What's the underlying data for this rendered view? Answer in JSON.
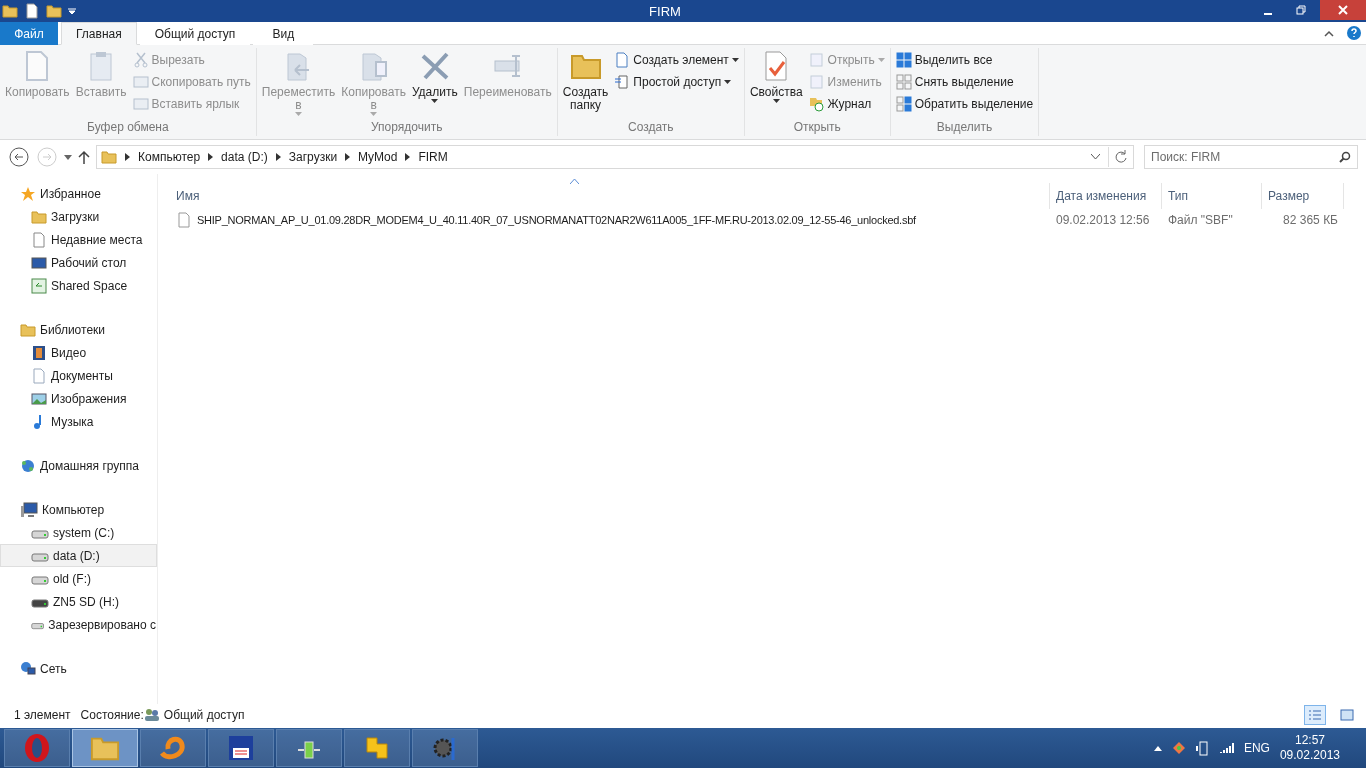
{
  "window": {
    "title": "FIRM"
  },
  "ribbon": {
    "tabs": [
      {
        "label": "Файл",
        "kind": "file",
        "selected": false
      },
      {
        "label": "Главная",
        "kind": "tab",
        "selected": true
      },
      {
        "label": "Общий доступ",
        "kind": "tab",
        "selected": false
      },
      {
        "label": "Вид",
        "kind": "tab",
        "selected": false
      }
    ],
    "groups": [
      {
        "label": "Буфер обмена",
        "large": [
          {
            "label": "Копировать",
            "disabled": true,
            "dropdown": false
          },
          {
            "label": "Вставить",
            "disabled": true,
            "dropdown": false
          }
        ],
        "small": [
          {
            "label": "Вырезать",
            "disabled": true,
            "dropdown": false
          },
          {
            "label": "Скопировать путь",
            "disabled": true,
            "dropdown": false
          },
          {
            "label": "Вставить ярлык",
            "disabled": true,
            "dropdown": false
          }
        ]
      },
      {
        "label": "Упорядочить",
        "large": [
          {
            "label": "Переместить\nв",
            "disabled": true,
            "dropdown": true
          },
          {
            "label": "Копировать\nв",
            "disabled": true,
            "dropdown": true
          },
          {
            "label": "Удалить",
            "disabled": false,
            "dropdown": true
          },
          {
            "label": "Переименовать",
            "disabled": true,
            "dropdown": false
          }
        ]
      },
      {
        "label": "Создать",
        "large": [
          {
            "label": "Создать\nпапку",
            "disabled": false,
            "dropdown": false
          }
        ],
        "small": [
          {
            "label": "Создать элемент",
            "disabled": false,
            "dropdown": true
          },
          {
            "label": "Простой доступ",
            "disabled": false,
            "dropdown": true
          }
        ]
      },
      {
        "label": "Открыть",
        "large": [
          {
            "label": "Свойства",
            "disabled": false,
            "dropdown": true
          }
        ],
        "small": [
          {
            "label": "Открыть",
            "disabled": true,
            "dropdown": true
          },
          {
            "label": "Изменить",
            "disabled": true,
            "dropdown": false
          },
          {
            "label": "Журнал",
            "disabled": false,
            "dropdown": false
          }
        ]
      },
      {
        "label": "Выделить",
        "small": [
          {
            "label": "Выделить все",
            "disabled": false,
            "dropdown": false
          },
          {
            "label": "Снять выделение",
            "disabled": false,
            "dropdown": false
          },
          {
            "label": "Обратить выделение",
            "disabled": false,
            "dropdown": false
          }
        ]
      }
    ]
  },
  "navigation": {
    "back_disabled": false,
    "forward_disabled": true,
    "breadcrumbs": [
      "Компьютер",
      "data (D:)",
      "Загрузки",
      "MyMod",
      "FIRM"
    ],
    "search": {
      "placeholder": "Поиск: FIRM"
    }
  },
  "sidebar": {
    "sections": [
      {
        "label": "Избранное",
        "children": [
          {
            "label": "Загрузки",
            "selected": false
          },
          {
            "label": "Недавние места",
            "selected": false
          },
          {
            "label": "Рабочий стол",
            "selected": false
          },
          {
            "label": "Shared Space",
            "selected": false
          }
        ]
      },
      {
        "label": "Библиотеки",
        "children": [
          {
            "label": "Видео",
            "selected": false
          },
          {
            "label": "Документы",
            "selected": false
          },
          {
            "label": "Изображения",
            "selected": false
          },
          {
            "label": "Музыка",
            "selected": false
          }
        ]
      },
      {
        "label": "Домашняя группа"
      },
      {
        "label": "Компьютер",
        "children": [
          {
            "label": "system (C:)",
            "selected": false
          },
          {
            "label": "data (D:)",
            "selected": true
          },
          {
            "label": "old (F:)",
            "selected": false
          },
          {
            "label": "ZN5 SD (H:)",
            "selected": false
          },
          {
            "label": "Зарезервировано с",
            "selected": false
          }
        ]
      },
      {
        "label": "Сеть"
      }
    ]
  },
  "table": {
    "columns": [
      "Имя",
      "Дата изменения",
      "Тип",
      "Размер"
    ],
    "rows": [
      {
        "cells": [
          "SHIP_NORMAN_AP_U_01.09.28DR_MODEM4_U_40.11.40R_07_USNORMANATT02NAR2W611A005_1FF-MF.RU-2013.02.09_12-55-46_unlocked.sbf",
          "09.02.2013 12:56",
          "Файл \"SBF\"",
          "82 365 КБ"
        ],
        "selected": false
      }
    ]
  },
  "status_bar": {
    "count": "1 элемент",
    "state_label": "Состояние:",
    "state_value": "Общий доступ",
    "views": [
      {
        "kind": "details",
        "selected": true
      },
      {
        "kind": "icons",
        "selected": false
      }
    ]
  },
  "taskbar": {
    "apps": [
      {
        "kind": "opera",
        "selected": false
      },
      {
        "kind": "explorer",
        "selected": true
      },
      {
        "kind": "swirl",
        "selected": false
      },
      {
        "kind": "floppy",
        "selected": false
      },
      {
        "kind": "green",
        "selected": false
      },
      {
        "kind": "yellow",
        "selected": false
      },
      {
        "kind": "tools",
        "selected": false
      }
    ],
    "language": "ENG",
    "time": "12:57",
    "date": "09.02.2013"
  }
}
